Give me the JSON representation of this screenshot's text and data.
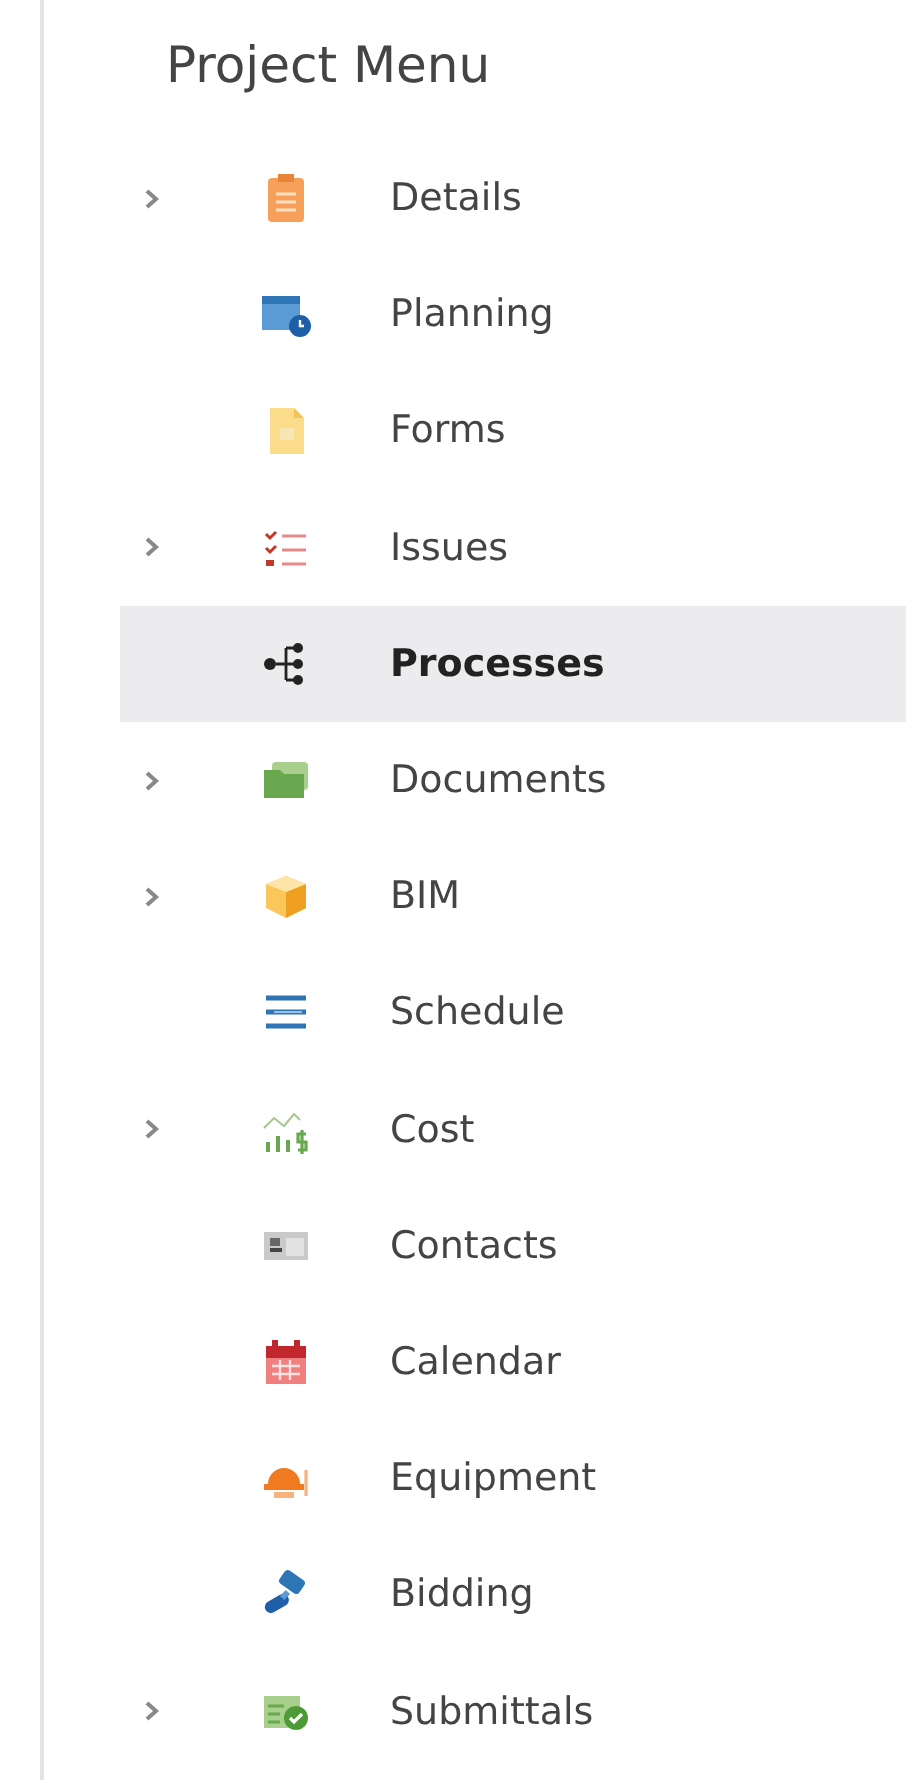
{
  "title": "Project Menu",
  "items": [
    {
      "label": "Details",
      "expandable": true,
      "selected": false
    },
    {
      "label": "Planning",
      "expandable": false,
      "selected": false
    },
    {
      "label": "Forms",
      "expandable": false,
      "selected": false
    },
    {
      "label": "Issues",
      "expandable": true,
      "selected": false
    },
    {
      "label": "Processes",
      "expandable": false,
      "selected": true
    },
    {
      "label": "Documents",
      "expandable": true,
      "selected": false
    },
    {
      "label": "BIM",
      "expandable": true,
      "selected": false
    },
    {
      "label": "Schedule",
      "expandable": false,
      "selected": false
    },
    {
      "label": "Cost",
      "expandable": true,
      "selected": false
    },
    {
      "label": "Contacts",
      "expandable": false,
      "selected": false
    },
    {
      "label": "Calendar",
      "expandable": false,
      "selected": false
    },
    {
      "label": "Equipment",
      "expandable": false,
      "selected": false
    },
    {
      "label": "Bidding",
      "expandable": false,
      "selected": false
    },
    {
      "label": "Submittals",
      "expandable": true,
      "selected": false
    }
  ]
}
